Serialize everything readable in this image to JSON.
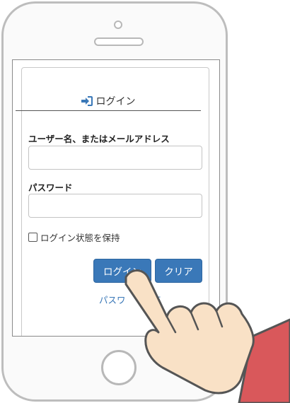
{
  "login": {
    "title": "ログイン",
    "username_label": "ユーザー名、またはメールアドレス",
    "username_value": "",
    "password_label": "パスワード",
    "password_value": "",
    "remember_label": "ログイン状態を保持",
    "login_button": "ログイン",
    "clear_button": "クリア",
    "forgot_link": "パスワ　　　忘"
  },
  "colors": {
    "accent": "#3a78b8",
    "phone_frame": "#bdbdbd",
    "hand_skin": "#f9e1c6",
    "sleeve": "#d9585b"
  },
  "icons": [
    "login-icon",
    "checkbox-icon",
    "pointing-hand"
  ]
}
